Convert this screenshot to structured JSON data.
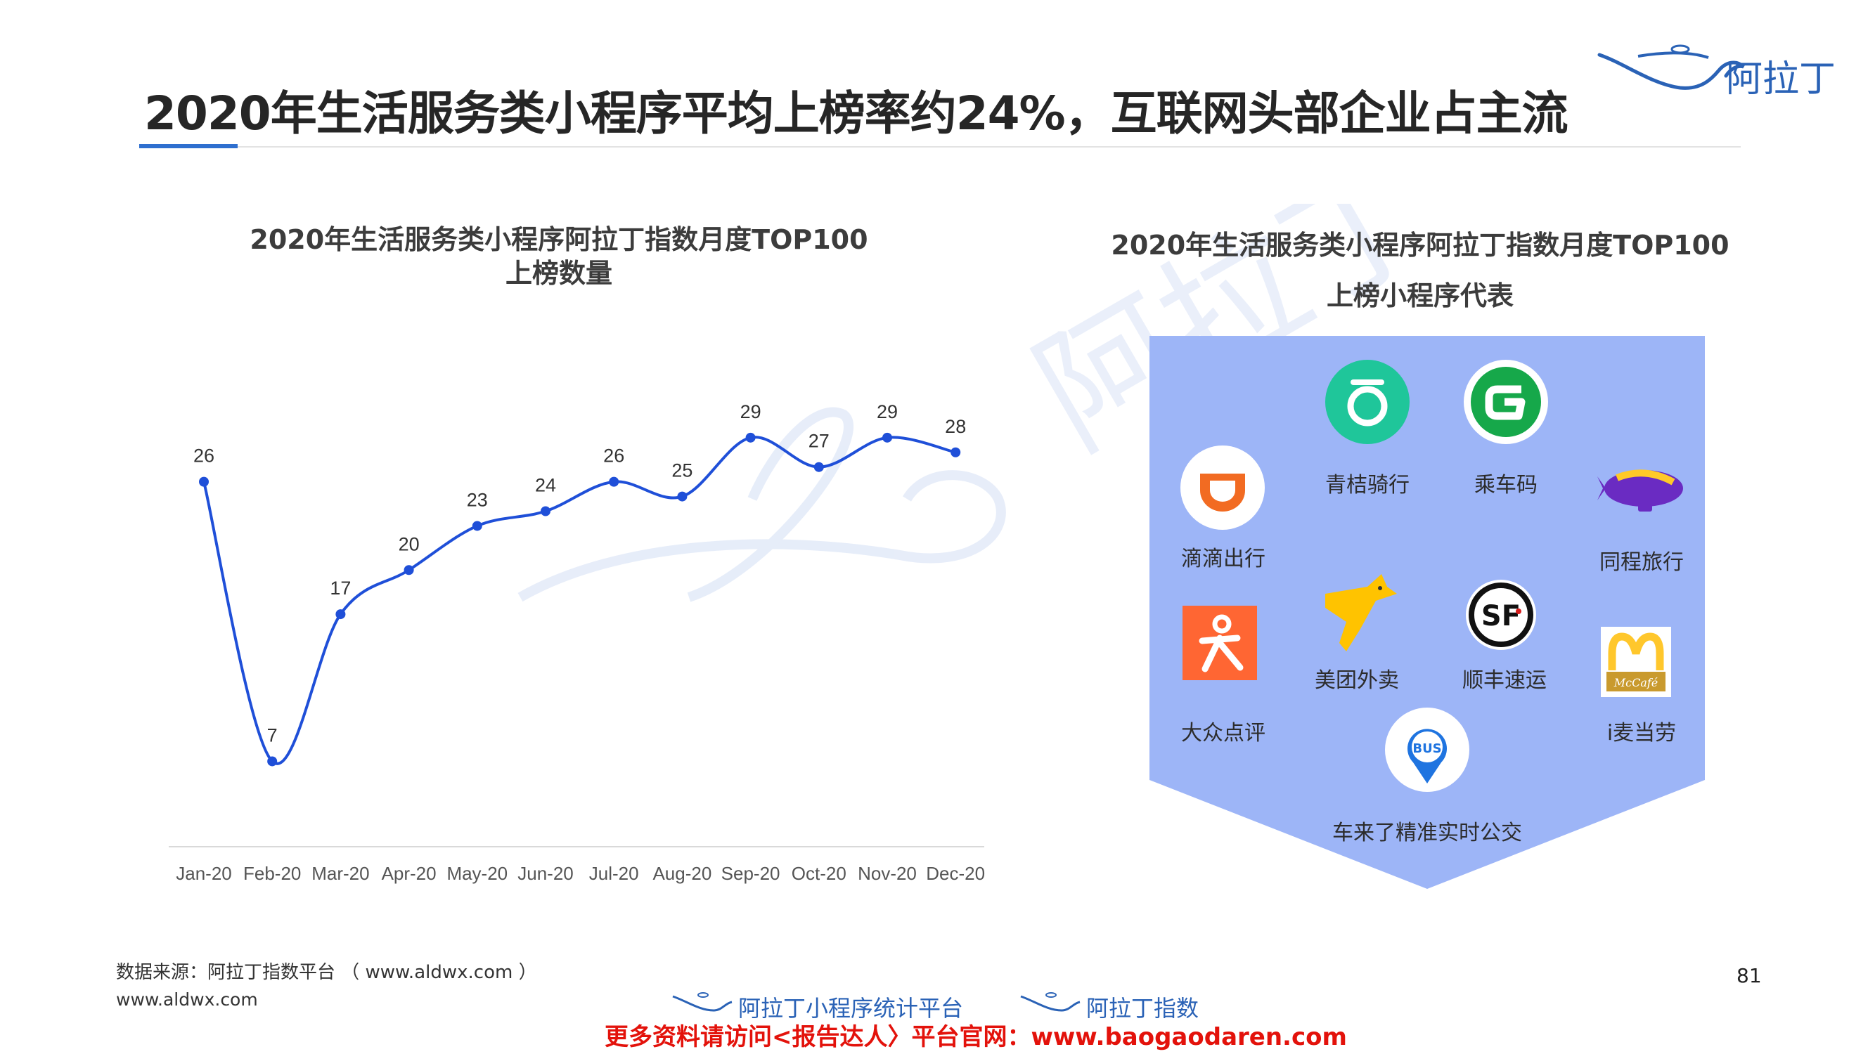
{
  "title": "2020年生活服务类小程序平均上榜率约24%，互联网头部企业占主流",
  "logo": {
    "text": "阿拉丁",
    "icon": "genie-lamp-icon"
  },
  "chart_title_line1": "2020年生活服务类小程序阿拉丁指数月度TOP100",
  "chart_title_line2": "上榜数量",
  "chart_data": {
    "type": "line",
    "title": "2020年生活服务类小程序阿拉丁指数月度TOP100上榜数量",
    "categories": [
      "Jan-20",
      "Feb-20",
      "Mar-20",
      "Apr-20",
      "May-20",
      "Jun-20",
      "Jul-20",
      "Aug-20",
      "Sep-20",
      "Oct-20",
      "Nov-20",
      "Dec-20"
    ],
    "values": [
      26,
      7,
      17,
      20,
      23,
      24,
      26,
      25,
      29,
      27,
      29,
      28
    ],
    "ylim": [
      0,
      32
    ],
    "grid": false,
    "legend": false,
    "line_color": "#1f4fd8"
  },
  "panel": {
    "title_line1": "2020年生活服务类小程序阿拉丁指数月度TOP100",
    "title_line2": "上榜小程序代表",
    "bg_color": "#9db5f7",
    "apps": [
      {
        "name": "滴滴出行",
        "icon": "didi-icon"
      },
      {
        "name": "青桔骑行",
        "icon": "qingju-icon"
      },
      {
        "name": "乘车码",
        "icon": "ride-code-icon"
      },
      {
        "name": "同程旅行",
        "icon": "ly-blimp-icon"
      },
      {
        "name": "大众点评",
        "icon": "dianping-icon"
      },
      {
        "name": "美团外卖",
        "icon": "meituan-kangaroo-icon"
      },
      {
        "name": "顺丰速运",
        "icon": "sf-express-icon"
      },
      {
        "name": "i麦当劳",
        "icon": "mcdonalds-icon"
      },
      {
        "name": "车来了精准实时公交",
        "icon": "bus-pin-icon"
      }
    ]
  },
  "source": "数据来源：阿拉丁指数平台 （ www.aldwx.com ）",
  "site": "www.aldwx.com",
  "page_number": "81",
  "footer": {
    "brand1": "阿拉丁小程序统计平台",
    "brand2": "阿拉丁指数",
    "link": "更多资料请访问<报告达人〉平台官网：www.baogaodaren.com"
  },
  "watermark_text": "阿拉丁"
}
